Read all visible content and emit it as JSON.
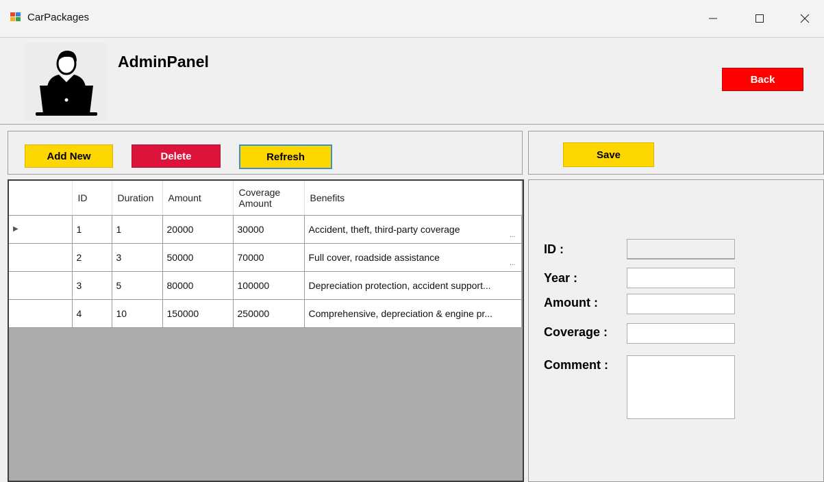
{
  "window": {
    "title": "CarPackages",
    "minimize_icon": "minimize-icon",
    "maximize_icon": "maximize-icon",
    "close_icon": "close-icon"
  },
  "header": {
    "title": "AdminPanel",
    "avatar_icon": "admin-laptop-icon",
    "back_label": "Back"
  },
  "toolbar": {
    "add_label": "Add New",
    "delete_label": "Delete",
    "refresh_label": "Refresh",
    "save_label": "Save"
  },
  "grid": {
    "columns": [
      "ID",
      "Duration",
      "Amount",
      "Coverage Amount",
      "Benefits"
    ],
    "rows": [
      {
        "id": "1",
        "duration": "1",
        "amount": "20000",
        "coverage": "30000",
        "benefits": "Accident, theft, third-party coverage",
        "selected": true
      },
      {
        "id": "2",
        "duration": "3",
        "amount": "50000",
        "coverage": "70000",
        "benefits": "Full cover, roadside assistance",
        "selected": false
      },
      {
        "id": "3",
        "duration": "5",
        "amount": "80000",
        "coverage": "100000",
        "benefits": "Depreciation protection, accident support...",
        "selected": false
      },
      {
        "id": "4",
        "duration": "10",
        "amount": "150000",
        "coverage": "250000",
        "benefits": "Comprehensive, depreciation & engine pr...",
        "selected": false
      }
    ]
  },
  "form": {
    "id_label": "ID :",
    "year_label": "Year :",
    "amount_label": "Amount :",
    "coverage_label": "Coverage :",
    "comment_label": "Comment :",
    "id_value": "",
    "year_value": "",
    "amount_value": "",
    "coverage_value": "",
    "comment_value": ""
  },
  "colors": {
    "yellow": "#ffd700",
    "crimson": "#dc143c",
    "red": "#ff0000",
    "grid_bg": "#ababab"
  }
}
